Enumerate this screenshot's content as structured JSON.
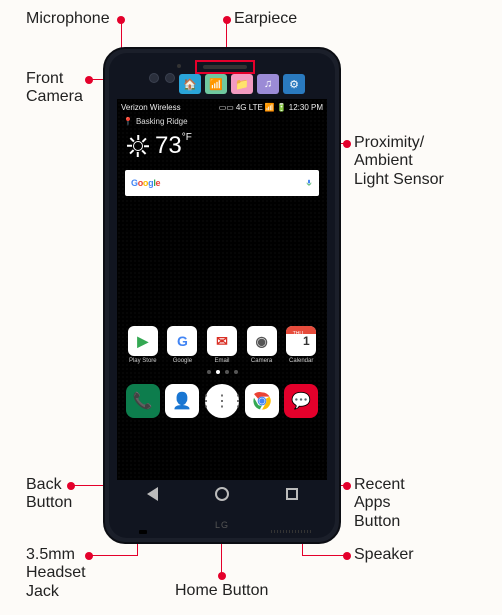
{
  "labels": {
    "microphone": "Microphone",
    "earpiece": "Earpiece",
    "front_camera": "Front\nCamera",
    "proximity": "Proximity/\nAmbient\nLight Sensor",
    "back_button": "Back\nButton",
    "home_button": "Home Button",
    "recent_apps": "Recent\nApps\nButton",
    "headset_jack": "3.5mm\nHeadset\nJack",
    "speaker": "Speaker"
  },
  "accent_color": "#e4002b",
  "statusbar": {
    "carrier": "Verizon Wireless",
    "time": "12:30 PM",
    "signal": "4G LTE"
  },
  "location": "Basking Ridge",
  "weather": {
    "temp": "73",
    "unit": "°F"
  },
  "search": {
    "brand": "Google"
  },
  "second_screen": [
    {
      "bg": "#2aa4d8",
      "glyph": "🏠"
    },
    {
      "bg": "#6fc8a0",
      "glyph": "📶"
    },
    {
      "bg": "#f29bc1",
      "glyph": "📁"
    },
    {
      "bg": "#9b8bd6",
      "glyph": "♫"
    },
    {
      "bg": "#2a7abf",
      "glyph": "⚙"
    }
  ],
  "apps": [
    {
      "label": "Play Store",
      "bg": "#ffffff",
      "glyph": "▶",
      "gc": "#34a853"
    },
    {
      "label": "Google",
      "bg": "#ffffff",
      "glyph": "G",
      "gc": "#4285F4"
    },
    {
      "label": "Email",
      "bg": "#ffffff",
      "glyph": "✉",
      "gc": "#d93025"
    },
    {
      "label": "Camera",
      "bg": "#ffffff",
      "glyph": "◉",
      "gc": "#555"
    },
    {
      "label": "Calendar",
      "bg": "calendar",
      "glyph": "1",
      "gc": "#333",
      "sub": "THU"
    }
  ],
  "dock": [
    {
      "bg": "#0d7d4d",
      "glyph": "📞"
    },
    {
      "bg": "#ffffff",
      "glyph": "👤"
    },
    {
      "bg": "#ffffff",
      "glyph": "⋮⋮⋮",
      "round": true
    },
    {
      "bg": "#ffffff",
      "glyph": "chrome"
    },
    {
      "bg": "#e4002b",
      "glyph": "💬"
    }
  ],
  "brand": "LG"
}
